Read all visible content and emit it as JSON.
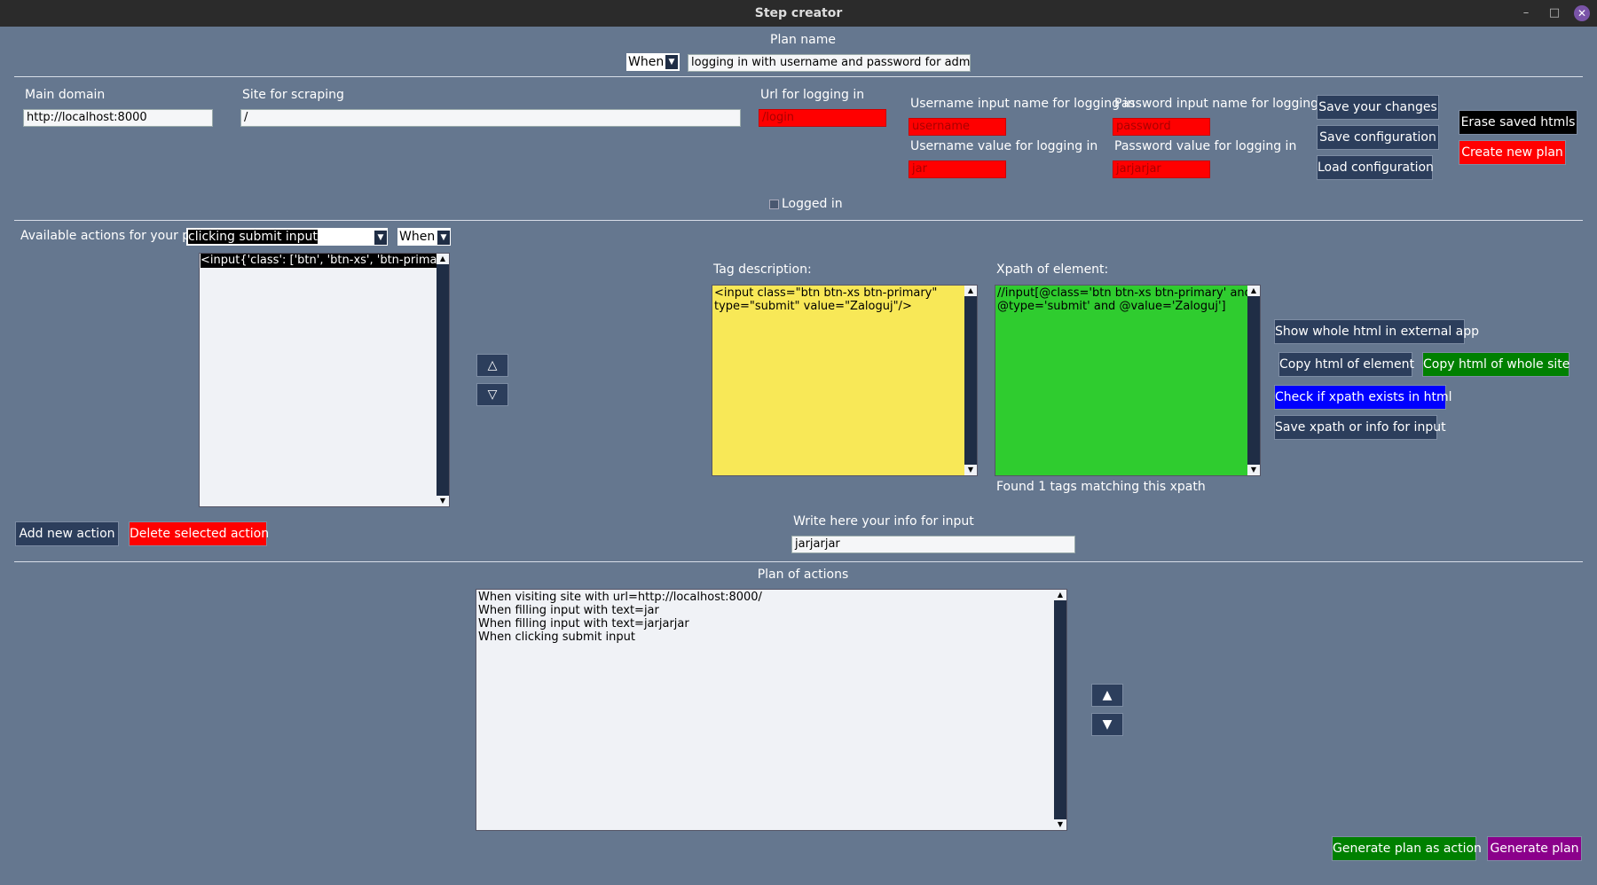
{
  "window": {
    "title": "Step creator",
    "minimize": "–",
    "maximize": "□",
    "close": "✕"
  },
  "plan": {
    "name_label": "Plan name",
    "keyword": "When",
    "name": "logging in with username and password for admin"
  },
  "domain": {
    "main_domain_label": "Main domain",
    "main_domain": "http://localhost:8000",
    "site_label": "Site for scraping",
    "site": "/",
    "login_url_label": "Url for logging in",
    "login_url": "/login",
    "username_input_label": "Username input name for logging in",
    "username_input": "username",
    "password_input_label": "Password input name for logging in",
    "password_input": "password",
    "username_value_label": "Username value for logging in",
    "username_value": "jar",
    "password_value_label": "Password value for logging in",
    "password_value": "jarjarjar",
    "logged_in_label": "Logged in"
  },
  "config_buttons": {
    "save_changes": "Save your changes",
    "save_config": "Save configuration",
    "load_config": "Load configuration",
    "erase_htmls": "Erase saved htmls",
    "create_plan": "Create new plan"
  },
  "actions": {
    "label": "Available actions for your plan",
    "selected": "clicking submit input",
    "keyword": "When",
    "list": [
      "<input{'class': ['btn', 'btn-xs', 'btn-primary'], 'type"
    ],
    "up": "△",
    "down": "▽",
    "add": "Add new action",
    "delete": "Delete selected action"
  },
  "tag": {
    "label": "Tag description:",
    "text": "<input class=\"btn btn-xs btn-primary\"\ntype=\"submit\" value=\"Zaloguj\"/>"
  },
  "xpath": {
    "label": "Xpath of element:",
    "text": "//input[@class='btn btn-xs btn-primary' and\n@type='submit' and @value='Zaloguj']",
    "status": "Found 1 tags matching this xpath"
  },
  "element_buttons": {
    "show_html": "Show whole html in external app",
    "copy_element": "Copy html of element",
    "copy_site": "Copy html of whole site",
    "check_xpath": "Check if xpath exists in html",
    "save_xpath": "Save xpath or info for input"
  },
  "input_info": {
    "label": "Write here your info for input",
    "value": "jarjarjar"
  },
  "plan_actions": {
    "label": "Plan of actions",
    "text": "When visiting site with url=http://localhost:8000/\nWhen filling input with text=jar\nWhen filling input with text=jarjarjar\nWhen clicking submit input",
    "up": "▲",
    "down": "▼",
    "generate_action": "Generate plan as action",
    "generate": "Generate plan"
  },
  "colors": {
    "background": "#65778f",
    "tag_bg": "#f8e857",
    "xpath_bg": "#2fcc2f",
    "button": "#2c3e5c"
  }
}
